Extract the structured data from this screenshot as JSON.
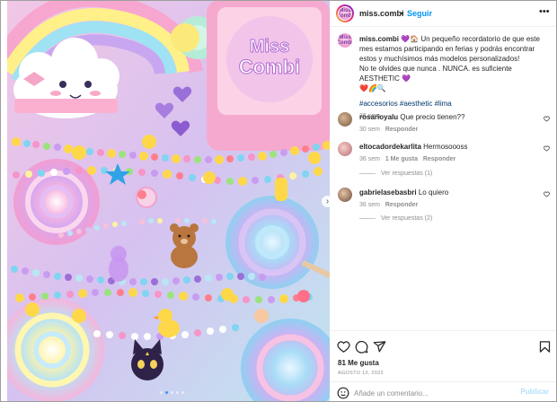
{
  "post": {
    "username": "miss.combi",
    "follow_label": "Seguir",
    "avatar_text": "Miss Combi"
  },
  "caption": {
    "username": "miss.combi",
    "text": "💜🏠 Un pequeño recordatorio de que este mes estamos participando en ferias y podrás encontrar estos y muchísimos más modelos personalizados!",
    "text2": "No te olvides que nunca . NUNCA. es suficiente AESTHETIC 💜",
    "emojis": "❤️🌈🔍",
    "hashtags": "#accesorios #aesthetic #lima",
    "time": "36 sem"
  },
  "comments": [
    {
      "user": "rosarioyalu",
      "text": "Que precio tienen??",
      "time": "30 sem",
      "reply": "Responder",
      "likes": "",
      "view_replies": ""
    },
    {
      "user": "eltocadordekarlita",
      "text": "Hermosoooss",
      "time": "36 sem",
      "likes": "1 Me gusta",
      "reply": "Responder",
      "view_replies": "Ver respuestas (1)"
    },
    {
      "user": "gabrielasebasbri",
      "text": "Lo quiero",
      "time": "36 sem",
      "reply": "Responder",
      "likes": "",
      "view_replies": "Ver respuestas (2)"
    }
  ],
  "actions": {
    "like_icon": "heart-icon",
    "comment_icon": "comment-icon",
    "share_icon": "share-icon",
    "save_icon": "bookmark-icon"
  },
  "likes_label": "81 Me gusta",
  "date_label": "AGOSTO 13, 2022",
  "add_comment": {
    "placeholder": "Añade un comentario...",
    "publish_label": "Publicar"
  },
  "carousel": {
    "active_index": 1,
    "count": 5,
    "next_icon": "chevron-right-icon"
  },
  "colors": {
    "accent": "#0095f6",
    "link": "#00376b",
    "muted": "#8e8e8e"
  }
}
